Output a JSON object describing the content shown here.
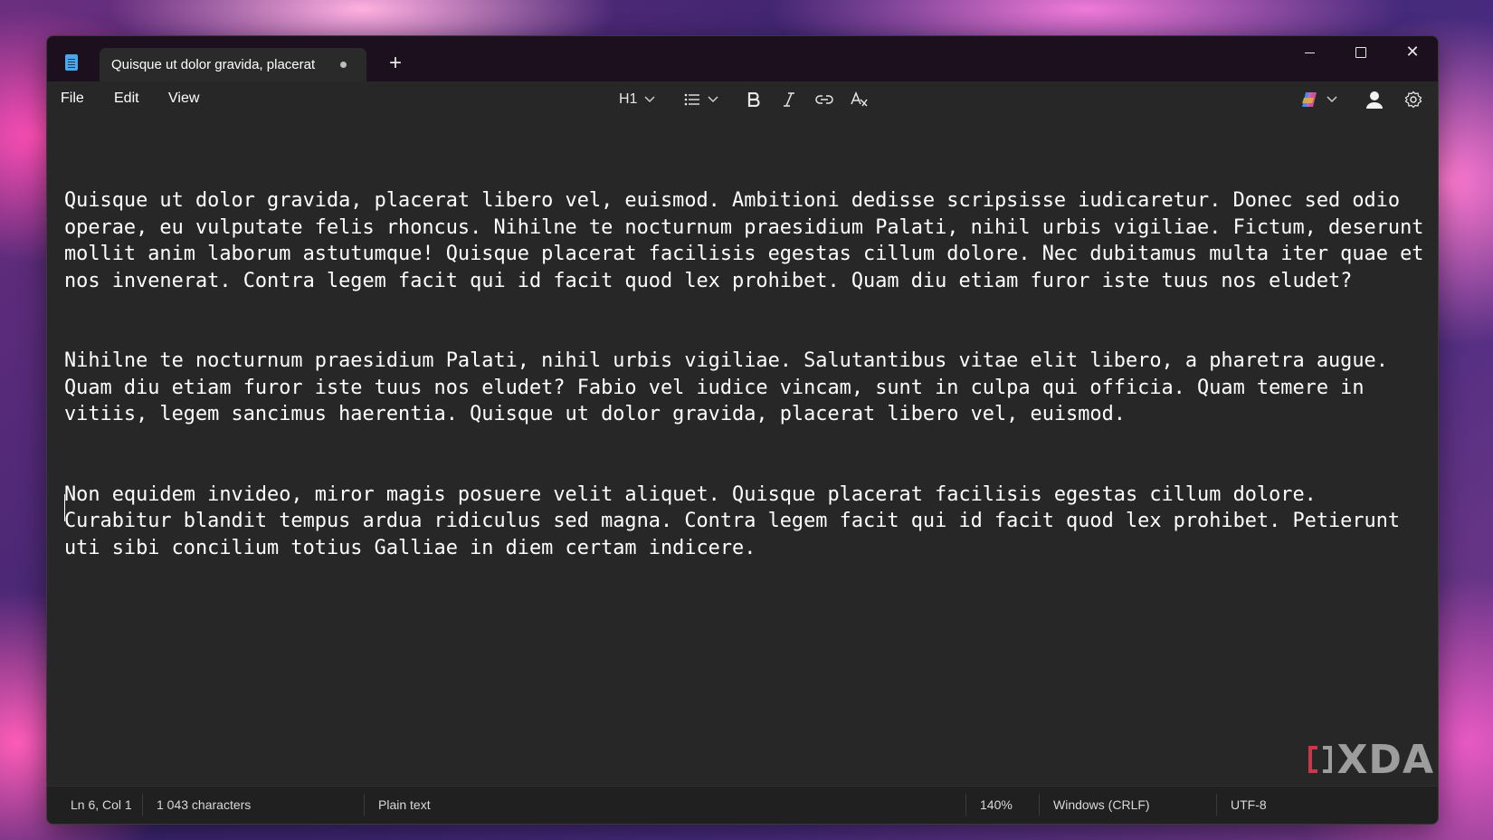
{
  "window": {
    "tab_title": "Quisque ut dolor gravida, placerat",
    "new_tab": "+",
    "controls": {
      "minimize": "minimize",
      "maximize": "maximize",
      "close": "✕"
    }
  },
  "menu": {
    "file": "File",
    "edit": "Edit",
    "view": "View"
  },
  "toolbar": {
    "heading": "H1",
    "icons": [
      "list-icon",
      "bold-icon",
      "italic-icon",
      "link-icon",
      "clear-format-icon",
      "copilot-icon",
      "account-icon",
      "settings-icon"
    ]
  },
  "editor": {
    "paragraphs": [
      "Quisque ut dolor gravida, placerat libero vel, euismod. Ambitioni dedisse scripsisse iudicaretur. Donec sed odio operae, eu vulputate felis rhoncus. Nihilne te nocturnum praesidium Palati, nihil urbis vigiliae. Fictum, deserunt mollit anim laborum astutumque! Quisque placerat facilisis egestas cillum dolore. Nec dubitamus multa iter quae et nos invenerat. Contra legem facit qui id facit quod lex prohibet. Quam diu etiam furor iste tuus nos eludet?",
      "Nihilne te nocturnum praesidium Palati, nihil urbis vigiliae. Salutantibus vitae elit libero, a pharetra augue. Quam diu etiam furor iste tuus nos eludet? Fabio vel iudice vincam, sunt in culpa qui officia. Quam temere in vitiis, legem sancimus haerentia. Quisque ut dolor gravida, placerat libero vel, euismod.",
      "Non equidem invideo, miror magis posuere velit aliquet. Quisque placerat facilisis egestas cillum dolore. Curabitur blandit tempus ardua ridiculus sed magna. Contra legem facit qui id facit quod lex prohibet. Petierunt uti sibi concilium totius Galliae in diem certam indicere."
    ]
  },
  "watermark": "XDA",
  "status": {
    "position": "Ln 6, Col 1",
    "characters": "1 043 characters",
    "format": "Plain text",
    "zoom": "140%",
    "line_endings": "Windows (CRLF)",
    "encoding": "UTF-8"
  },
  "colors": {
    "editor_bg": "#272727",
    "titlebar_bg": "#1c0f1e",
    "statusbar_bg": "#202020",
    "text": "#ffffff",
    "spellcheck": "#e0303a"
  }
}
